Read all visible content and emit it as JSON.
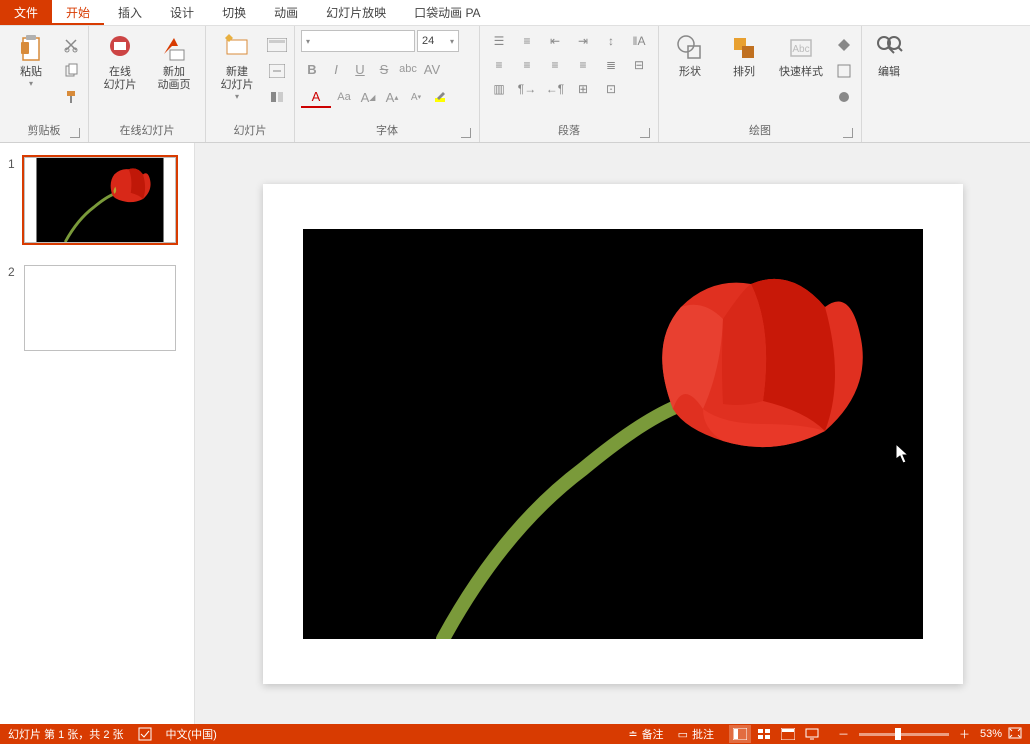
{
  "tabs": {
    "file": "文件",
    "home": "开始",
    "insert": "插入",
    "design": "设计",
    "transition": "切换",
    "animation": "动画",
    "slideshow": "幻灯片放映",
    "pa": "口袋动画 PA"
  },
  "ribbon": {
    "clipboard": {
      "paste": "粘贴",
      "label": "剪贴板"
    },
    "online": {
      "online_slides": "在线\n幻灯片",
      "new_anim": "新加\n动画页",
      "label": "在线幻灯片"
    },
    "slides": {
      "new_slide": "新建\n幻灯片",
      "label": "幻灯片"
    },
    "font": {
      "size": "24",
      "label": "字体"
    },
    "paragraph": {
      "label": "段落"
    },
    "drawing": {
      "shapes": "形状",
      "arrange": "排列",
      "quick_styles": "快速样式",
      "label": "绘图"
    },
    "editing": {
      "edit": "编辑"
    }
  },
  "thumbnails": [
    {
      "num": "1",
      "has_image": true
    },
    {
      "num": "2",
      "has_image": false
    }
  ],
  "statusbar": {
    "slide_info": "幻灯片 第 1 张，共 2 张",
    "language": "中文(中国)",
    "notes": "备注",
    "comments": "批注",
    "zoom": "53%"
  },
  "colors": {
    "accent": "#d83b01"
  }
}
